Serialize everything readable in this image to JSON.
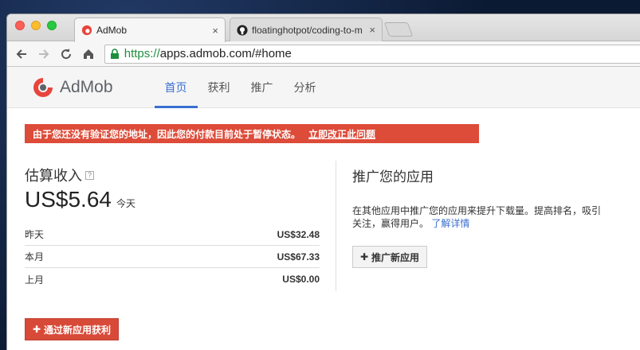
{
  "browser": {
    "tabs": [
      {
        "title": "AdMob",
        "close": "×",
        "icon": "admob-favicon"
      },
      {
        "title": "floatinghotpot/coding-to-m",
        "close": "×",
        "icon": "github-favicon"
      }
    ],
    "url": {
      "scheme": "https://",
      "rest": "apps.admob.com/#home"
    }
  },
  "app": {
    "logo_text": "AdMob",
    "nav": [
      "首页",
      "获利",
      "推广",
      "分析"
    ],
    "alert": {
      "message": "由于您还没有验证您的地址，因此您的付款目前处于暂停状态。",
      "link": "立即改正此问题"
    },
    "earnings": {
      "title": "估算收入",
      "help": "?",
      "value": "US$5.64",
      "period": "今天",
      "rows": [
        {
          "label": "昨天",
          "value": "US$32.48"
        },
        {
          "label": "本月",
          "value": "US$67.33"
        },
        {
          "label": "上月",
          "value": "US$0.00"
        }
      ]
    },
    "promote": {
      "title": "推广您的应用",
      "desc_line1": "在其他应用中推广您的应用来提升下载量。提高排名，吸引",
      "desc_line2": "关注，赢得用户。",
      "learn_more": "了解详情",
      "button": "推广新应用"
    },
    "monetize_button": "通过新应用获利"
  }
}
